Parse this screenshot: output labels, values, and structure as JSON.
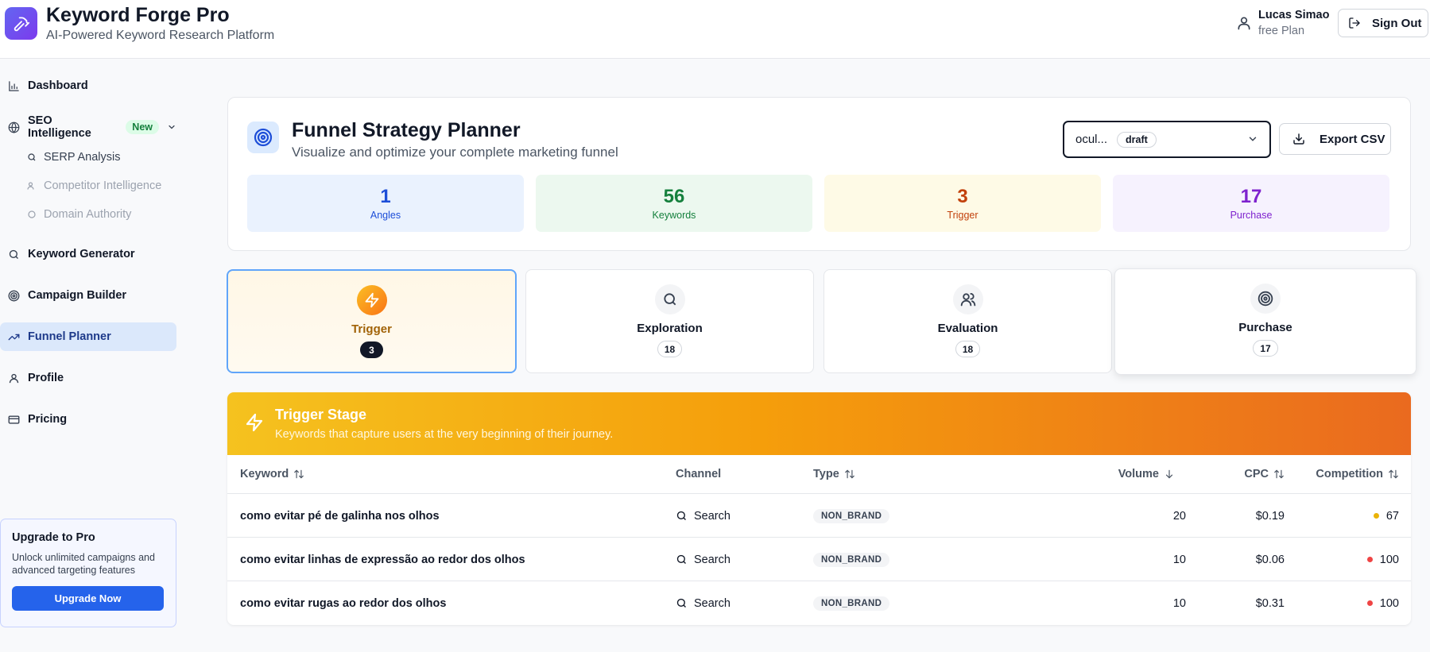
{
  "header": {
    "title": "Keyword Forge Pro",
    "subtitle": "AI-Powered Keyword Research Platform",
    "user_name": "Lucas Simao",
    "user_plan": "free Plan",
    "signout_label": "Sign Out"
  },
  "sidebar": {
    "items": [
      {
        "label": "Dashboard",
        "icon": "bar-chart-icon"
      },
      {
        "label": "SEO Intelligence",
        "icon": "globe-icon",
        "badge": "New"
      },
      {
        "label": "Keyword Generator",
        "icon": "search-icon"
      },
      {
        "label": "Campaign Builder",
        "icon": "target-icon"
      },
      {
        "label": "Funnel Planner",
        "icon": "trending-up-icon",
        "active": true
      },
      {
        "label": "Profile",
        "icon": "user-icon"
      },
      {
        "label": "Pricing",
        "icon": "credit-card-icon"
      }
    ],
    "sub_items": [
      {
        "label": "SERP Analysis",
        "icon": "search-icon"
      },
      {
        "label": "Competitor Intelligence",
        "icon": "users-icon"
      },
      {
        "label": "Domain Authority",
        "icon": "shield-icon"
      }
    ],
    "upgrade": {
      "title": "Upgrade to Pro",
      "text": "Unlock unlimited campaigns and advanced targeting features",
      "button": "Upgrade Now"
    }
  },
  "planner": {
    "title": "Funnel Strategy Planner",
    "subtitle": "Visualize and optimize your complete marketing funnel",
    "campaign_select": "ocul...",
    "campaign_status": "draft",
    "export_label": "Export CSV",
    "stats": [
      {
        "value": "1",
        "label": "Angles",
        "color": "#1d4ed8",
        "bg": "#eaf2fe"
      },
      {
        "value": "56",
        "label": "Keywords",
        "color": "#15803d",
        "bg": "#ecf8ef"
      },
      {
        "value": "3",
        "label": "Trigger",
        "color": "#c2410c",
        "bg": "#fefae6"
      },
      {
        "value": "17",
        "label": "Purchase",
        "color": "#7e22ce",
        "bg": "#f6f2fe"
      }
    ]
  },
  "stages": [
    {
      "name": "Trigger",
      "count": "3",
      "icon": "zap-icon"
    },
    {
      "name": "Exploration",
      "count": "18",
      "icon": "search-icon"
    },
    {
      "name": "Evaluation",
      "count": "18",
      "icon": "users-icon"
    },
    {
      "name": "Purchase",
      "count": "17",
      "icon": "target-icon"
    }
  ],
  "stage_panel": {
    "title": "Trigger Stage",
    "subtitle": "Keywords that capture users at the very beginning of their journey."
  },
  "table": {
    "headers": {
      "keyword": "Keyword",
      "channel": "Channel",
      "type": "Type",
      "volume": "Volume",
      "cpc": "CPC",
      "competition": "Competition"
    },
    "rows": [
      {
        "keyword": "como evitar pé de galinha nos olhos",
        "channel": "Search",
        "type": "NON_BRAND",
        "volume": "20",
        "cpc": "$0.19",
        "competition": "67",
        "comp_color": "#eab308"
      },
      {
        "keyword": "como evitar linhas de expressão ao redor dos olhos",
        "channel": "Search",
        "type": "NON_BRAND",
        "volume": "10",
        "cpc": "$0.06",
        "competition": "100",
        "comp_color": "#ef4444"
      },
      {
        "keyword": "como evitar rugas ao redor dos olhos",
        "channel": "Search",
        "type": "NON_BRAND",
        "volume": "10",
        "cpc": "$0.31",
        "competition": "100",
        "comp_color": "#ef4444"
      }
    ]
  }
}
